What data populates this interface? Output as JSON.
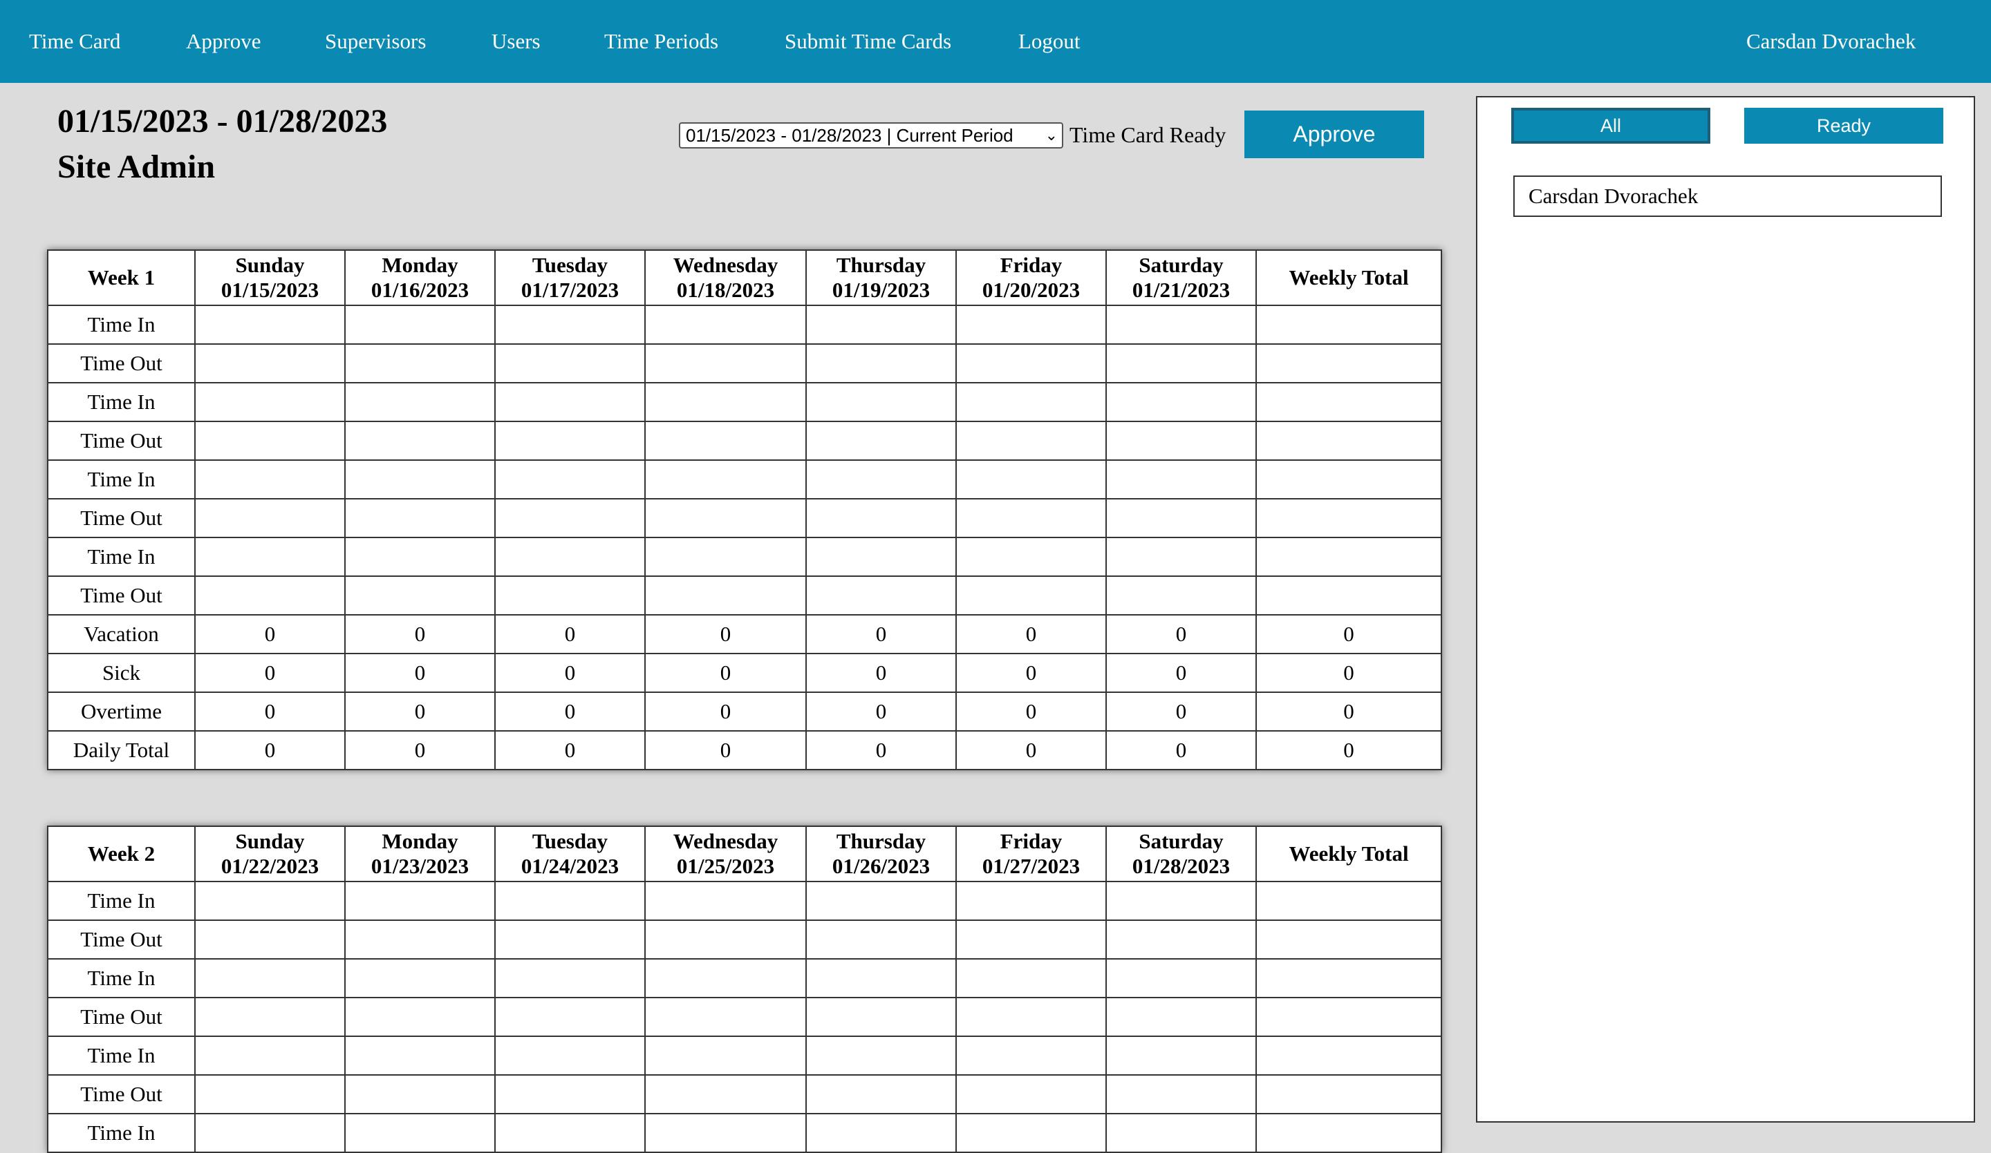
{
  "nav": {
    "items": [
      {
        "name": "nav-time-card",
        "label": "Time Card"
      },
      {
        "name": "nav-approve",
        "label": "Approve"
      },
      {
        "name": "nav-supervisors",
        "label": "Supervisors"
      },
      {
        "name": "nav-users",
        "label": "Users"
      },
      {
        "name": "nav-time-periods",
        "label": "Time Periods"
      },
      {
        "name": "nav-submit-time-cards",
        "label": "Submit Time Cards"
      },
      {
        "name": "nav-logout",
        "label": "Logout"
      }
    ],
    "user": "Carsdan Dvorachek"
  },
  "header": {
    "period": "01/15/2023 - 01/28/2023",
    "subtitle": "Site Admin",
    "select_value": "01/15/2023 - 01/28/2023 | Current Period",
    "ready_label": "Time Card Ready",
    "approve_label": "Approve"
  },
  "weeks": [
    {
      "label": "Week 1",
      "days": [
        {
          "day": "Sunday",
          "date": "01/15/2023"
        },
        {
          "day": "Monday",
          "date": "01/16/2023"
        },
        {
          "day": "Tuesday",
          "date": "01/17/2023"
        },
        {
          "day": "Wednesday",
          "date": "01/18/2023"
        },
        {
          "day": "Thursday",
          "date": "01/19/2023"
        },
        {
          "day": "Friday",
          "date": "01/20/2023"
        },
        {
          "day": "Saturday",
          "date": "01/21/2023"
        }
      ],
      "total_header": "Weekly Total",
      "rows": [
        {
          "label": "Time In",
          "cells": [
            "",
            "",
            "",
            "",
            "",
            "",
            "",
            ""
          ]
        },
        {
          "label": "Time Out",
          "cells": [
            "",
            "",
            "",
            "",
            "",
            "",
            "",
            ""
          ]
        },
        {
          "label": "Time In",
          "cells": [
            "",
            "",
            "",
            "",
            "",
            "",
            "",
            ""
          ]
        },
        {
          "label": "Time Out",
          "cells": [
            "",
            "",
            "",
            "",
            "",
            "",
            "",
            ""
          ]
        },
        {
          "label": "Time In",
          "cells": [
            "",
            "",
            "",
            "",
            "",
            "",
            "",
            ""
          ]
        },
        {
          "label": "Time Out",
          "cells": [
            "",
            "",
            "",
            "",
            "",
            "",
            "",
            ""
          ]
        },
        {
          "label": "Time In",
          "cells": [
            "",
            "",
            "",
            "",
            "",
            "",
            "",
            ""
          ]
        },
        {
          "label": "Time Out",
          "cells": [
            "",
            "",
            "",
            "",
            "",
            "",
            "",
            ""
          ]
        },
        {
          "label": "Vacation",
          "cells": [
            "0",
            "0",
            "0",
            "0",
            "0",
            "0",
            "0",
            "0"
          ]
        },
        {
          "label": "Sick",
          "cells": [
            "0",
            "0",
            "0",
            "0",
            "0",
            "0",
            "0",
            "0"
          ]
        },
        {
          "label": "Overtime",
          "cells": [
            "0",
            "0",
            "0",
            "0",
            "0",
            "0",
            "0",
            "0"
          ]
        },
        {
          "label": "Daily Total",
          "cells": [
            "0",
            "0",
            "0",
            "0",
            "0",
            "0",
            "0",
            "0"
          ]
        }
      ]
    },
    {
      "label": "Week 2",
      "days": [
        {
          "day": "Sunday",
          "date": "01/22/2023"
        },
        {
          "day": "Monday",
          "date": "01/23/2023"
        },
        {
          "day": "Tuesday",
          "date": "01/24/2023"
        },
        {
          "day": "Wednesday",
          "date": "01/25/2023"
        },
        {
          "day": "Thursday",
          "date": "01/26/2023"
        },
        {
          "day": "Friday",
          "date": "01/27/2023"
        },
        {
          "day": "Saturday",
          "date": "01/28/2023"
        }
      ],
      "total_header": "Weekly Total",
      "rows": [
        {
          "label": "Time In",
          "cells": [
            "",
            "",
            "",
            "",
            "",
            "",
            "",
            ""
          ]
        },
        {
          "label": "Time Out",
          "cells": [
            "",
            "",
            "",
            "",
            "",
            "",
            "",
            ""
          ]
        },
        {
          "label": "Time In",
          "cells": [
            "",
            "",
            "",
            "",
            "",
            "",
            "",
            ""
          ]
        },
        {
          "label": "Time Out",
          "cells": [
            "",
            "",
            "",
            "",
            "",
            "",
            "",
            ""
          ]
        },
        {
          "label": "Time In",
          "cells": [
            "",
            "",
            "",
            "",
            "",
            "",
            "",
            ""
          ]
        },
        {
          "label": "Time Out",
          "cells": [
            "",
            "",
            "",
            "",
            "",
            "",
            "",
            ""
          ]
        },
        {
          "label": "Time In",
          "cells": [
            "",
            "",
            "",
            "",
            "",
            "",
            "",
            ""
          ]
        }
      ]
    }
  ],
  "panel": {
    "filter_all": "All",
    "filter_ready": "Ready",
    "users": [
      "Carsdan Dvorachek"
    ]
  },
  "colors": {
    "accent": "#0a8ab2",
    "background": "#dcdcdc"
  }
}
